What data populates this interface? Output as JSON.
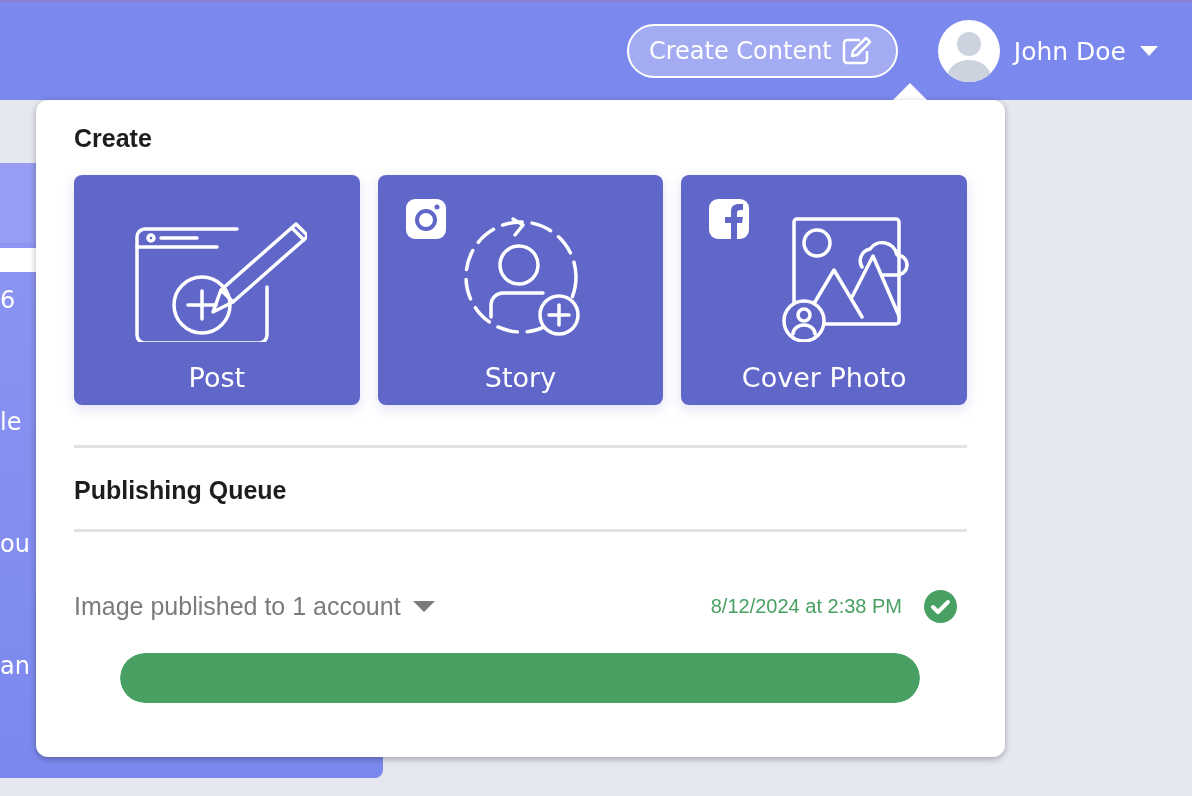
{
  "header": {
    "create_button": "Create Content",
    "user": {
      "name": "John Doe"
    }
  },
  "background_panel": {
    "texts": [
      "6",
      "le",
      "ou",
      "an"
    ]
  },
  "menu": {
    "create_title": "Create",
    "tiles": [
      {
        "label": "Post",
        "kind": "post"
      },
      {
        "label": "Story",
        "kind": "story",
        "badge": {
          "kind": "instagram"
        }
      },
      {
        "label": "Cover Photo",
        "kind": "cover",
        "badge": {
          "kind": "facebook"
        }
      }
    ],
    "queue_title": "Publishing Queue",
    "queue": [
      {
        "summary": "Image published to 1 account",
        "time": "8/12/2024 at 2:38 PM"
      }
    ]
  }
}
